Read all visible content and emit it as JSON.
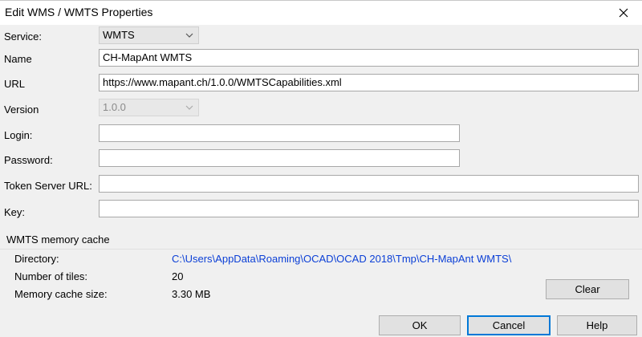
{
  "window": {
    "title": "Edit WMS / WMTS Properties",
    "close_icon": "close-icon"
  },
  "form": {
    "service_label": "Service:",
    "service_value": "WMTS",
    "name_label": "Name",
    "name_value": "CH-MapAnt WMTS",
    "url_label": "URL",
    "url_value": "https://www.mapant.ch/1.0.0/WMTSCapabilities.xml",
    "version_label": "Version",
    "version_value": "1.0.0",
    "login_label": "Login:",
    "login_value": "",
    "password_label": "Password:",
    "password_value": "",
    "token_label": "Token Server URL:",
    "token_value": "",
    "key_label": "Key:",
    "key_value": ""
  },
  "cache": {
    "group_title": "WMTS memory cache",
    "directory_label": "Directory:",
    "directory_value": "C:\\Users\\AppData\\Roaming\\OCAD\\OCAD 2018\\Tmp\\CH-MapAnt WMTS\\",
    "tiles_label": "Number of tiles:",
    "tiles_value": "20",
    "size_label": "Memory cache size:",
    "size_value": "3.30 MB",
    "clear_label": "Clear"
  },
  "buttons": {
    "ok": "OK",
    "cancel": "Cancel",
    "help": "Help"
  },
  "colors": {
    "link": "#0b3fd6",
    "focus": "#0078d7"
  }
}
